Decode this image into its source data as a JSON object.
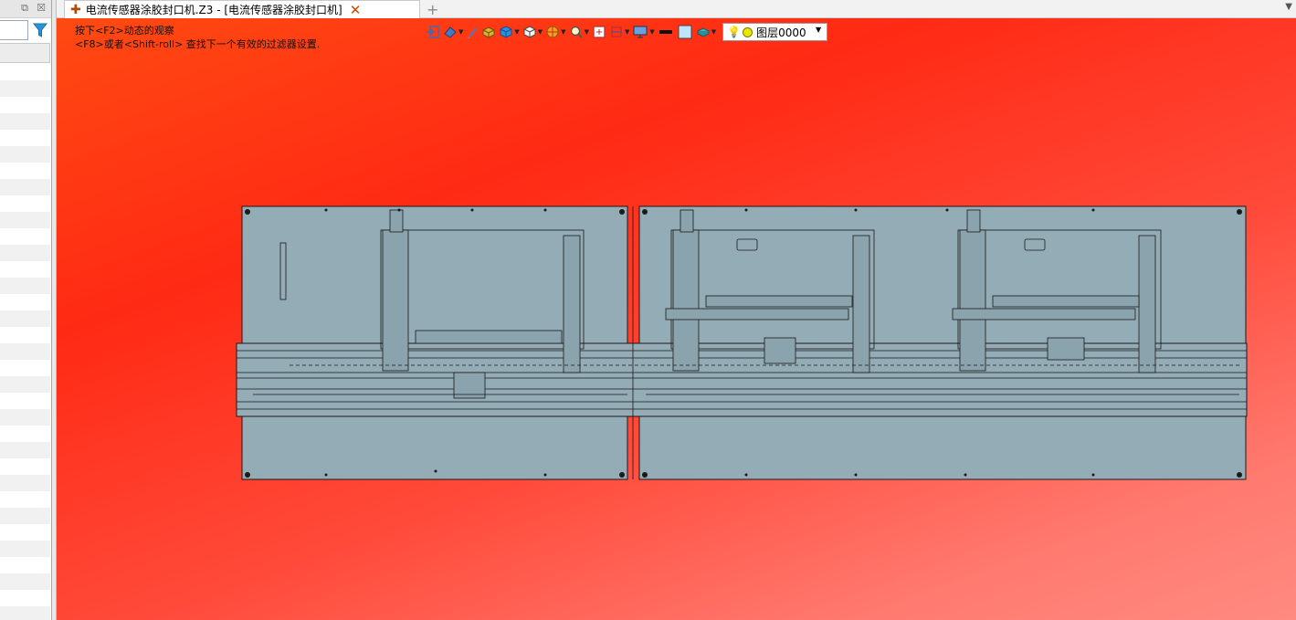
{
  "left_panel": {
    "restore_icon": "⧉",
    "close_icon": "☒",
    "filter_placeholder": ""
  },
  "tab": {
    "title": "电流传感器涂胶封口机.Z3 - [电流传感器涂胶封口机]",
    "new_tab_symbol": "+"
  },
  "viewport": {
    "hint_line1": "按下<F2>动态的观察",
    "hint_line2": "<F8>或者<Shift-roll> 查找下一个有效的过滤器设置."
  },
  "toolbar": {
    "layer_label": "图层0000"
  },
  "colors": {
    "accent_close": "#d04a00",
    "bg_gradient_top": "#ff3a10",
    "bg_gradient_bottom": "#ff8a80",
    "model_fill": "#94acb6"
  }
}
